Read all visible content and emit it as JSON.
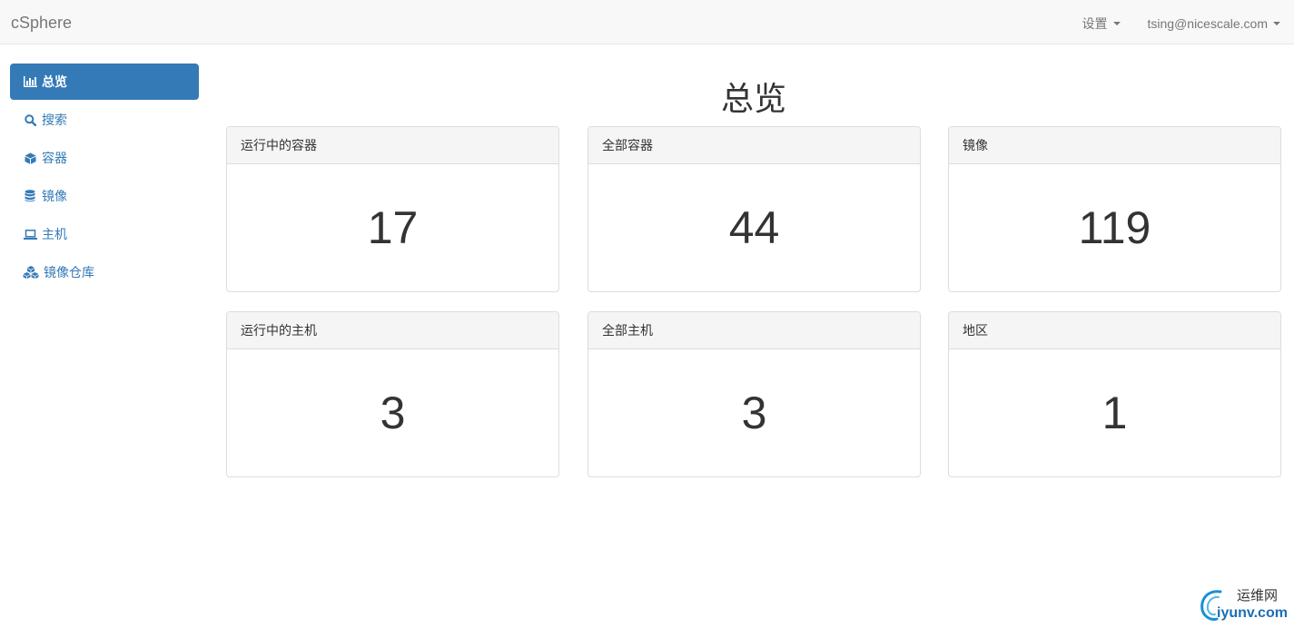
{
  "navbar": {
    "brand": "cSphere",
    "settings_label": "设置",
    "user_label": "tsing@nicescale.com"
  },
  "sidebar": {
    "items": [
      {
        "label": "总览",
        "icon": "bar-chart-icon",
        "active": true
      },
      {
        "label": "搜索",
        "icon": "search-icon",
        "active": false
      },
      {
        "label": "容器",
        "icon": "cube-icon",
        "active": false
      },
      {
        "label": "镜像",
        "icon": "database-icon",
        "active": false
      },
      {
        "label": "主机",
        "icon": "laptop-icon",
        "active": false
      },
      {
        "label": "镜像仓库",
        "icon": "cubes-icon",
        "active": false
      }
    ]
  },
  "main": {
    "title": "总览",
    "panels": [
      {
        "heading": "运行中的容器",
        "value": "17"
      },
      {
        "heading": "全部容器",
        "value": "44"
      },
      {
        "heading": "镜像",
        "value": "119"
      },
      {
        "heading": "运行中的主机",
        "value": "3"
      },
      {
        "heading": "全部主机",
        "value": "3"
      },
      {
        "heading": "地区",
        "value": "1"
      }
    ]
  },
  "watermark": {
    "cn_text": "运维网",
    "en_text": "iyunv.com"
  },
  "colors": {
    "accent": "#337ab7",
    "navbar_bg": "#f8f8f8",
    "panel_heading_bg": "#f5f5f5",
    "text": "#333333"
  }
}
